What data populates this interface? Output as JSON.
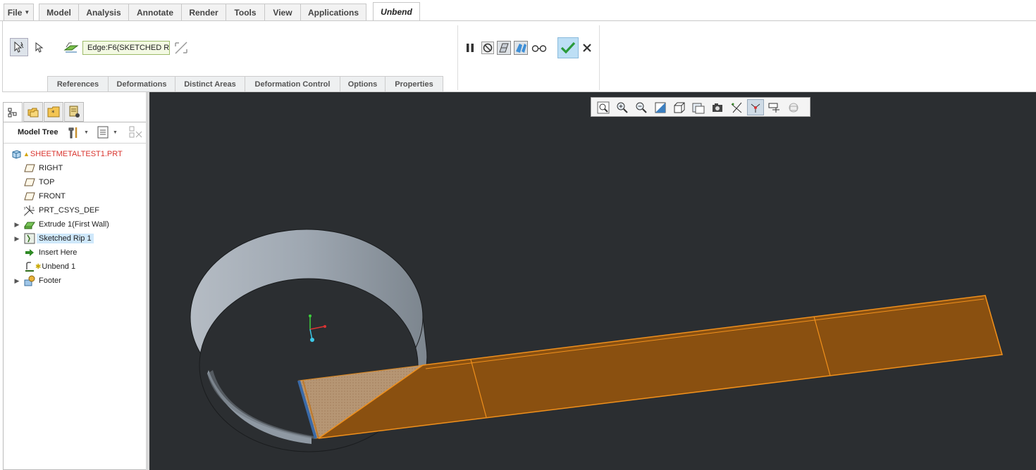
{
  "menu": {
    "file": "File",
    "tabs": [
      "Model",
      "Analysis",
      "Annotate",
      "Render",
      "Tools",
      "View",
      "Applications"
    ],
    "active_tab": "Unbend"
  },
  "ribbon": {
    "edge_field": "Edge:F6(SKETCHED RIP_",
    "sub_tabs": [
      "References",
      "Deformations",
      "Distinct Areas",
      "Deformation Control",
      "Options",
      "Properties"
    ]
  },
  "left_panel": {
    "title": "Model Tree",
    "tree": [
      {
        "label": "SHEETMETALTEST1.PRT",
        "icon": "part-icon"
      },
      {
        "label": "RIGHT",
        "icon": "datum-plane-icon"
      },
      {
        "label": "TOP",
        "icon": "datum-plane-icon"
      },
      {
        "label": "FRONT",
        "icon": "datum-plane-icon"
      },
      {
        "label": "PRT_CSYS_DEF",
        "icon": "csys-icon"
      },
      {
        "label": "Extrude 1(First Wall)",
        "icon": "extrude-wall-icon"
      },
      {
        "label": "Sketched Rip 1",
        "icon": "sketched-rip-icon"
      },
      {
        "label": "Insert Here",
        "icon": "insert-arrow-icon"
      },
      {
        "label": "Unbend 1",
        "icon": "unbend-icon"
      },
      {
        "label": "Footer",
        "icon": "footer-icon"
      }
    ]
  },
  "colors": {
    "viewport_bg": "#2b2e31",
    "flat_sheet": "#8a5010",
    "flat_edge": "#f0901c",
    "cylinder": "#9ea7b1",
    "part_name": "#d9332d",
    "selected_row": "#cfe8fb"
  }
}
